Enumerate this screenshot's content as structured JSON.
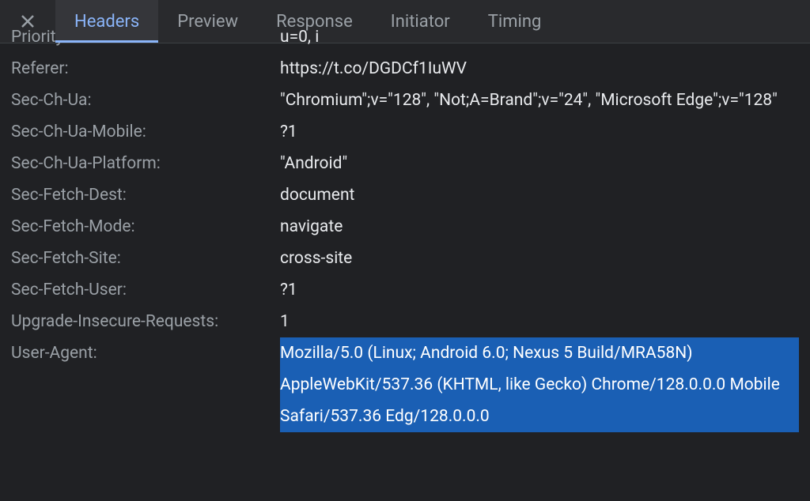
{
  "tabs": {
    "headers": "Headers",
    "preview": "Preview",
    "response": "Response",
    "initiator": "Initiator",
    "timing": "Timing"
  },
  "headers": [
    {
      "name": "Priority:",
      "value": "u=0, i"
    },
    {
      "name": "Referer:",
      "value": "https://t.co/DGDCf1IuWV"
    },
    {
      "name": "Sec-Ch-Ua:",
      "value": "\"Chromium\";v=\"128\", \"Not;A=Brand\";v=\"24\", \"Microsoft Edge\";v=\"128\""
    },
    {
      "name": "Sec-Ch-Ua-Mobile:",
      "value": "?1"
    },
    {
      "name": "Sec-Ch-Ua-Platform:",
      "value": "\"Android\""
    },
    {
      "name": "Sec-Fetch-Dest:",
      "value": "document"
    },
    {
      "name": "Sec-Fetch-Mode:",
      "value": "navigate"
    },
    {
      "name": "Sec-Fetch-Site:",
      "value": "cross-site"
    },
    {
      "name": "Sec-Fetch-User:",
      "value": "?1"
    },
    {
      "name": "Upgrade-Insecure-Requests:",
      "value": "1"
    },
    {
      "name": "User-Agent:",
      "value": "Mozilla/5.0 (Linux; Android 6.0; Nexus 5 Build/MRA58N) AppleWebKit/537.36 (KHTML, like Gecko) Chrome/128.0.0.0 Mobile Safari/537.36 Edg/128.0.0.0",
      "selected": true
    }
  ]
}
